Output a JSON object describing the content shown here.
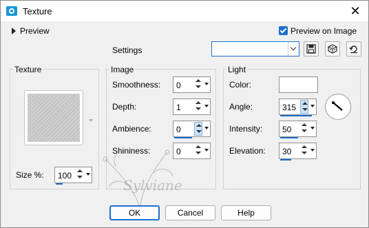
{
  "window": {
    "title": "Texture",
    "close_glyph": "✕"
  },
  "preview": {
    "label": "Preview",
    "preview_on_image_label": "Preview on Image",
    "preview_on_image_checked": true
  },
  "settings": {
    "label": "Settings",
    "value": "",
    "toolbar_icons": [
      "save-icon",
      "random-dice-icon",
      "reset-icon"
    ]
  },
  "texture_group": {
    "title": "Texture",
    "size_label": "Size %:",
    "size_value": "100"
  },
  "image_group": {
    "title": "Image",
    "smoothness_label": "Smoothness:",
    "smoothness_value": "0",
    "depth_label": "Depth:",
    "depth_value": "1",
    "ambience_label": "Ambience:",
    "ambience_value": "0",
    "shininess_label": "Shininess:",
    "shininess_value": "0"
  },
  "light_group": {
    "title": "Light",
    "color_label": "Color:",
    "color_value": "#ffffff",
    "angle_label": "Angle:",
    "angle_value": "315",
    "intensity_label": "Intensity:",
    "intensity_value": "50",
    "elevation_label": "Elevation:",
    "elevation_value": "30"
  },
  "buttons": {
    "ok": "OK",
    "cancel": "Cancel",
    "help": "Help"
  },
  "watermark": {
    "text": "Sylviane"
  },
  "colors": {
    "accent": "#1a6fce",
    "app_icon": "#1797d6",
    "dialog_bg": "#f0f0f0"
  }
}
